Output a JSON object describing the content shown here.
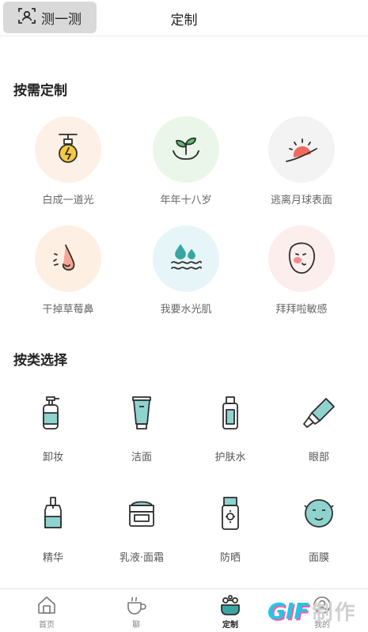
{
  "header": {
    "scan_label": "测一测",
    "title": "定制"
  },
  "sections": {
    "by_need": "按需定制",
    "by_category": "按类选择"
  },
  "needs": [
    {
      "label": "白成一道光",
      "icon": "lightbulb-icon",
      "bg": "#fdf0e6"
    },
    {
      "label": "年年十八岁",
      "icon": "sprout-hands-icon",
      "bg": "#eaf6ea"
    },
    {
      "label": "逃离月球表面",
      "icon": "sunrise-icon",
      "bg": "#f3f3f3"
    },
    {
      "label": "干掉草莓鼻",
      "icon": "nose-icon",
      "bg": "#fdf0e2"
    },
    {
      "label": "我要水光肌",
      "icon": "water-drops-icon",
      "bg": "#e6f5f7"
    },
    {
      "label": "拜拜啦敏感",
      "icon": "face-icon",
      "bg": "#fdeeee"
    }
  ],
  "categories": [
    {
      "label": "卸妆",
      "icon": "pump-bottle-icon"
    },
    {
      "label": "洁面",
      "icon": "cleanser-tube-icon"
    },
    {
      "label": "护肤水",
      "icon": "toner-bottle-icon"
    },
    {
      "label": "眼部",
      "icon": "eye-cream-tube-icon"
    },
    {
      "label": "精华",
      "icon": "serum-bottle-icon"
    },
    {
      "label": "乳液·面霜",
      "icon": "cream-jar-icon"
    },
    {
      "label": "防晒",
      "icon": "sunscreen-bottle-icon"
    },
    {
      "label": "面膜",
      "icon": "face-mask-icon"
    }
  ],
  "tabs": [
    {
      "label": "首页",
      "icon": "home-icon",
      "active": false
    },
    {
      "label": "聊",
      "icon": "coffee-cup-icon",
      "active": false
    },
    {
      "label": "定制",
      "icon": "customize-icon",
      "active": true
    },
    {
      "label": "我的",
      "icon": "profile-icon",
      "active": false
    }
  ],
  "watermark": {
    "gif": "GIF",
    "text": "制作"
  },
  "colors": {
    "teal": "#3aa6a3",
    "dark": "#2f2f2f",
    "yellow": "#f5c842",
    "accent_green": "#5cc06b"
  }
}
